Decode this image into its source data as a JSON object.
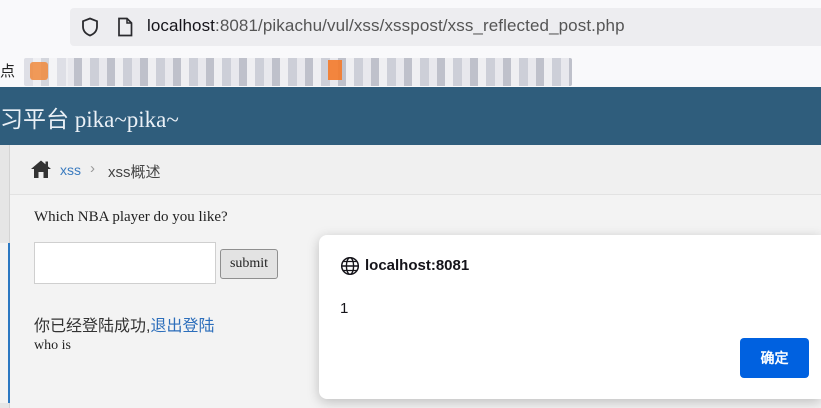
{
  "browser": {
    "url_host": "localhost",
    "url_rest": ":8081/pikachu/vul/xss/xsspost/xss_reflected_post.php",
    "bookmark_label": "点"
  },
  "site": {
    "title": "习平台 pika~pika~"
  },
  "breadcrumb": {
    "link": "xss",
    "separator": "›",
    "current": "xss概述"
  },
  "form": {
    "question": "Which NBA player do you like?",
    "input_value": "",
    "submit_label": "submit"
  },
  "status": {
    "logged_in_text": "你已经登陆成功,",
    "logout_link": "退出登陆",
    "who_is": "who is"
  },
  "dialog": {
    "origin": "localhost:8081",
    "message": "1",
    "ok_label": "确定"
  },
  "colors": {
    "header": "#2f5d7c",
    "link": "#3a7bbf",
    "ok_button": "#0061e0"
  }
}
